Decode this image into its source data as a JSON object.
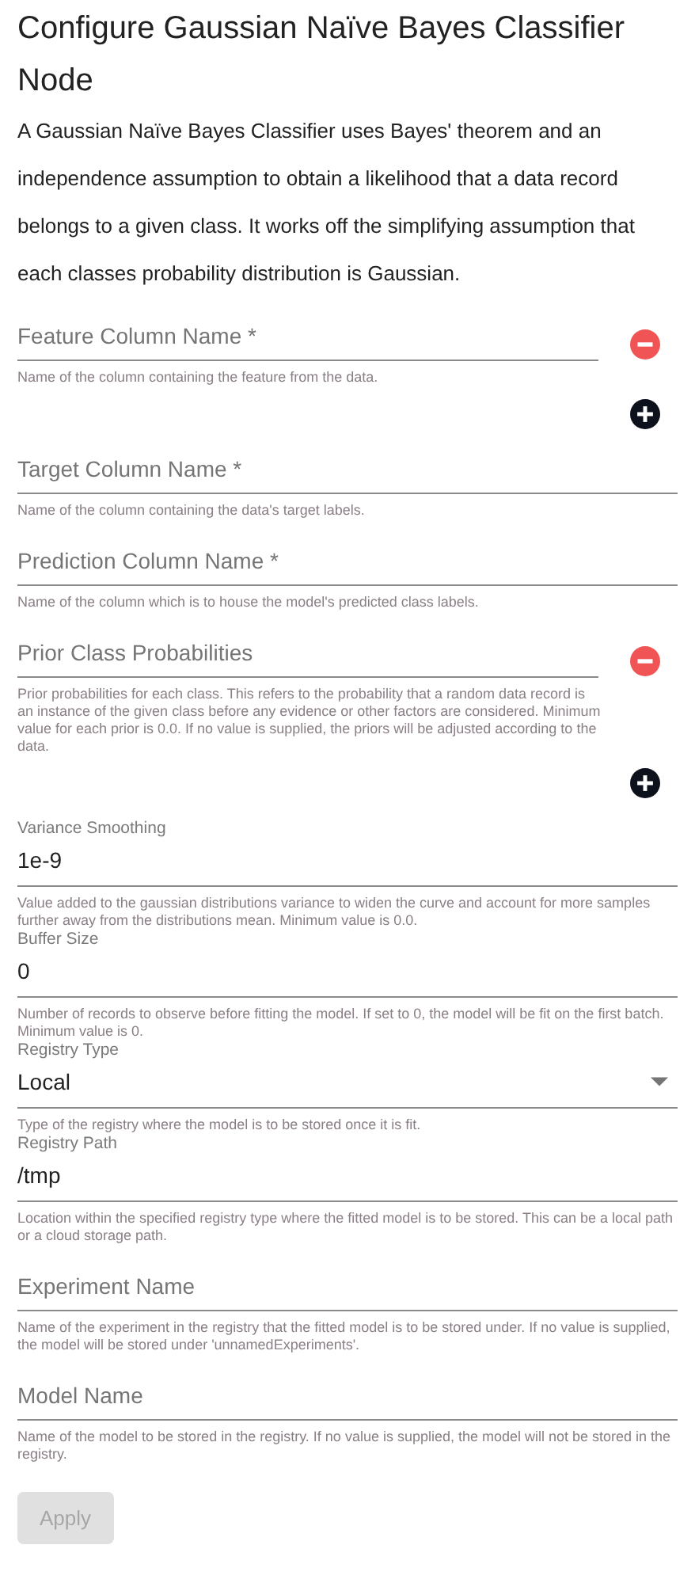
{
  "title": "Configure Gaussian Naïve Bayes Classifier Node",
  "description": "A Gaussian Naïve Bayes Classifier uses Bayes' theorem and an independence assumption to obtain a likelihood that a data record belongs to a given class. It works off the simplifying assumption that each classes probability distribution is Gaussian.",
  "fields": [
    {
      "kind": "list",
      "placeholder": "Feature Column Name *",
      "hint": "Name of the column containing the feature from the data."
    },
    {
      "kind": "text",
      "placeholder": "Target Column Name *",
      "hint": "Name of the column containing the data's target labels."
    },
    {
      "kind": "text",
      "placeholder": "Prediction Column Name *",
      "hint": "Name of the column which is to house the model's predicted class labels."
    },
    {
      "kind": "list",
      "placeholder": "Prior Class Probabilities",
      "hint": "Prior probabilities for each class. This refers to the probability that a random data record is an instance of the given class before any evidence or other factors are considered. Minimum value for each prior is 0.0. If no value is supplied, the priors will be adjusted according to the data."
    },
    {
      "kind": "filled",
      "label": "Variance Smoothing",
      "value": "1e-9",
      "hint": "Value added to the gaussian distributions variance to widen the curve and account for more samples further away from the distributions mean. Minimum value is 0.0."
    },
    {
      "kind": "filled",
      "label": "Buffer Size",
      "value": "0",
      "hint": "Number of records to observe before fitting the model. If set to 0, the model will be fit on the first batch. Minimum value is 0."
    },
    {
      "kind": "select",
      "label": "Registry Type",
      "value": "Local",
      "hint": "Type of the registry where the model is to be stored once it is fit."
    },
    {
      "kind": "filled",
      "label": "Registry Path",
      "value": "/tmp",
      "hint": "Location within the specified registry type where the fitted model is to be stored. This can be a local path or a cloud storage path."
    },
    {
      "kind": "text",
      "placeholder": "Experiment Name",
      "hint": "Name of the experiment in the registry that the fitted model is to be stored under. If no value is supplied, the model will be stored under 'unnamedExperiments'."
    },
    {
      "kind": "text",
      "placeholder": "Model Name",
      "hint": "Name of the model to be stored in the registry. If no value is supplied, the model will not be stored in the registry."
    }
  ],
  "apply": {
    "label": "Apply",
    "disabled": true
  }
}
